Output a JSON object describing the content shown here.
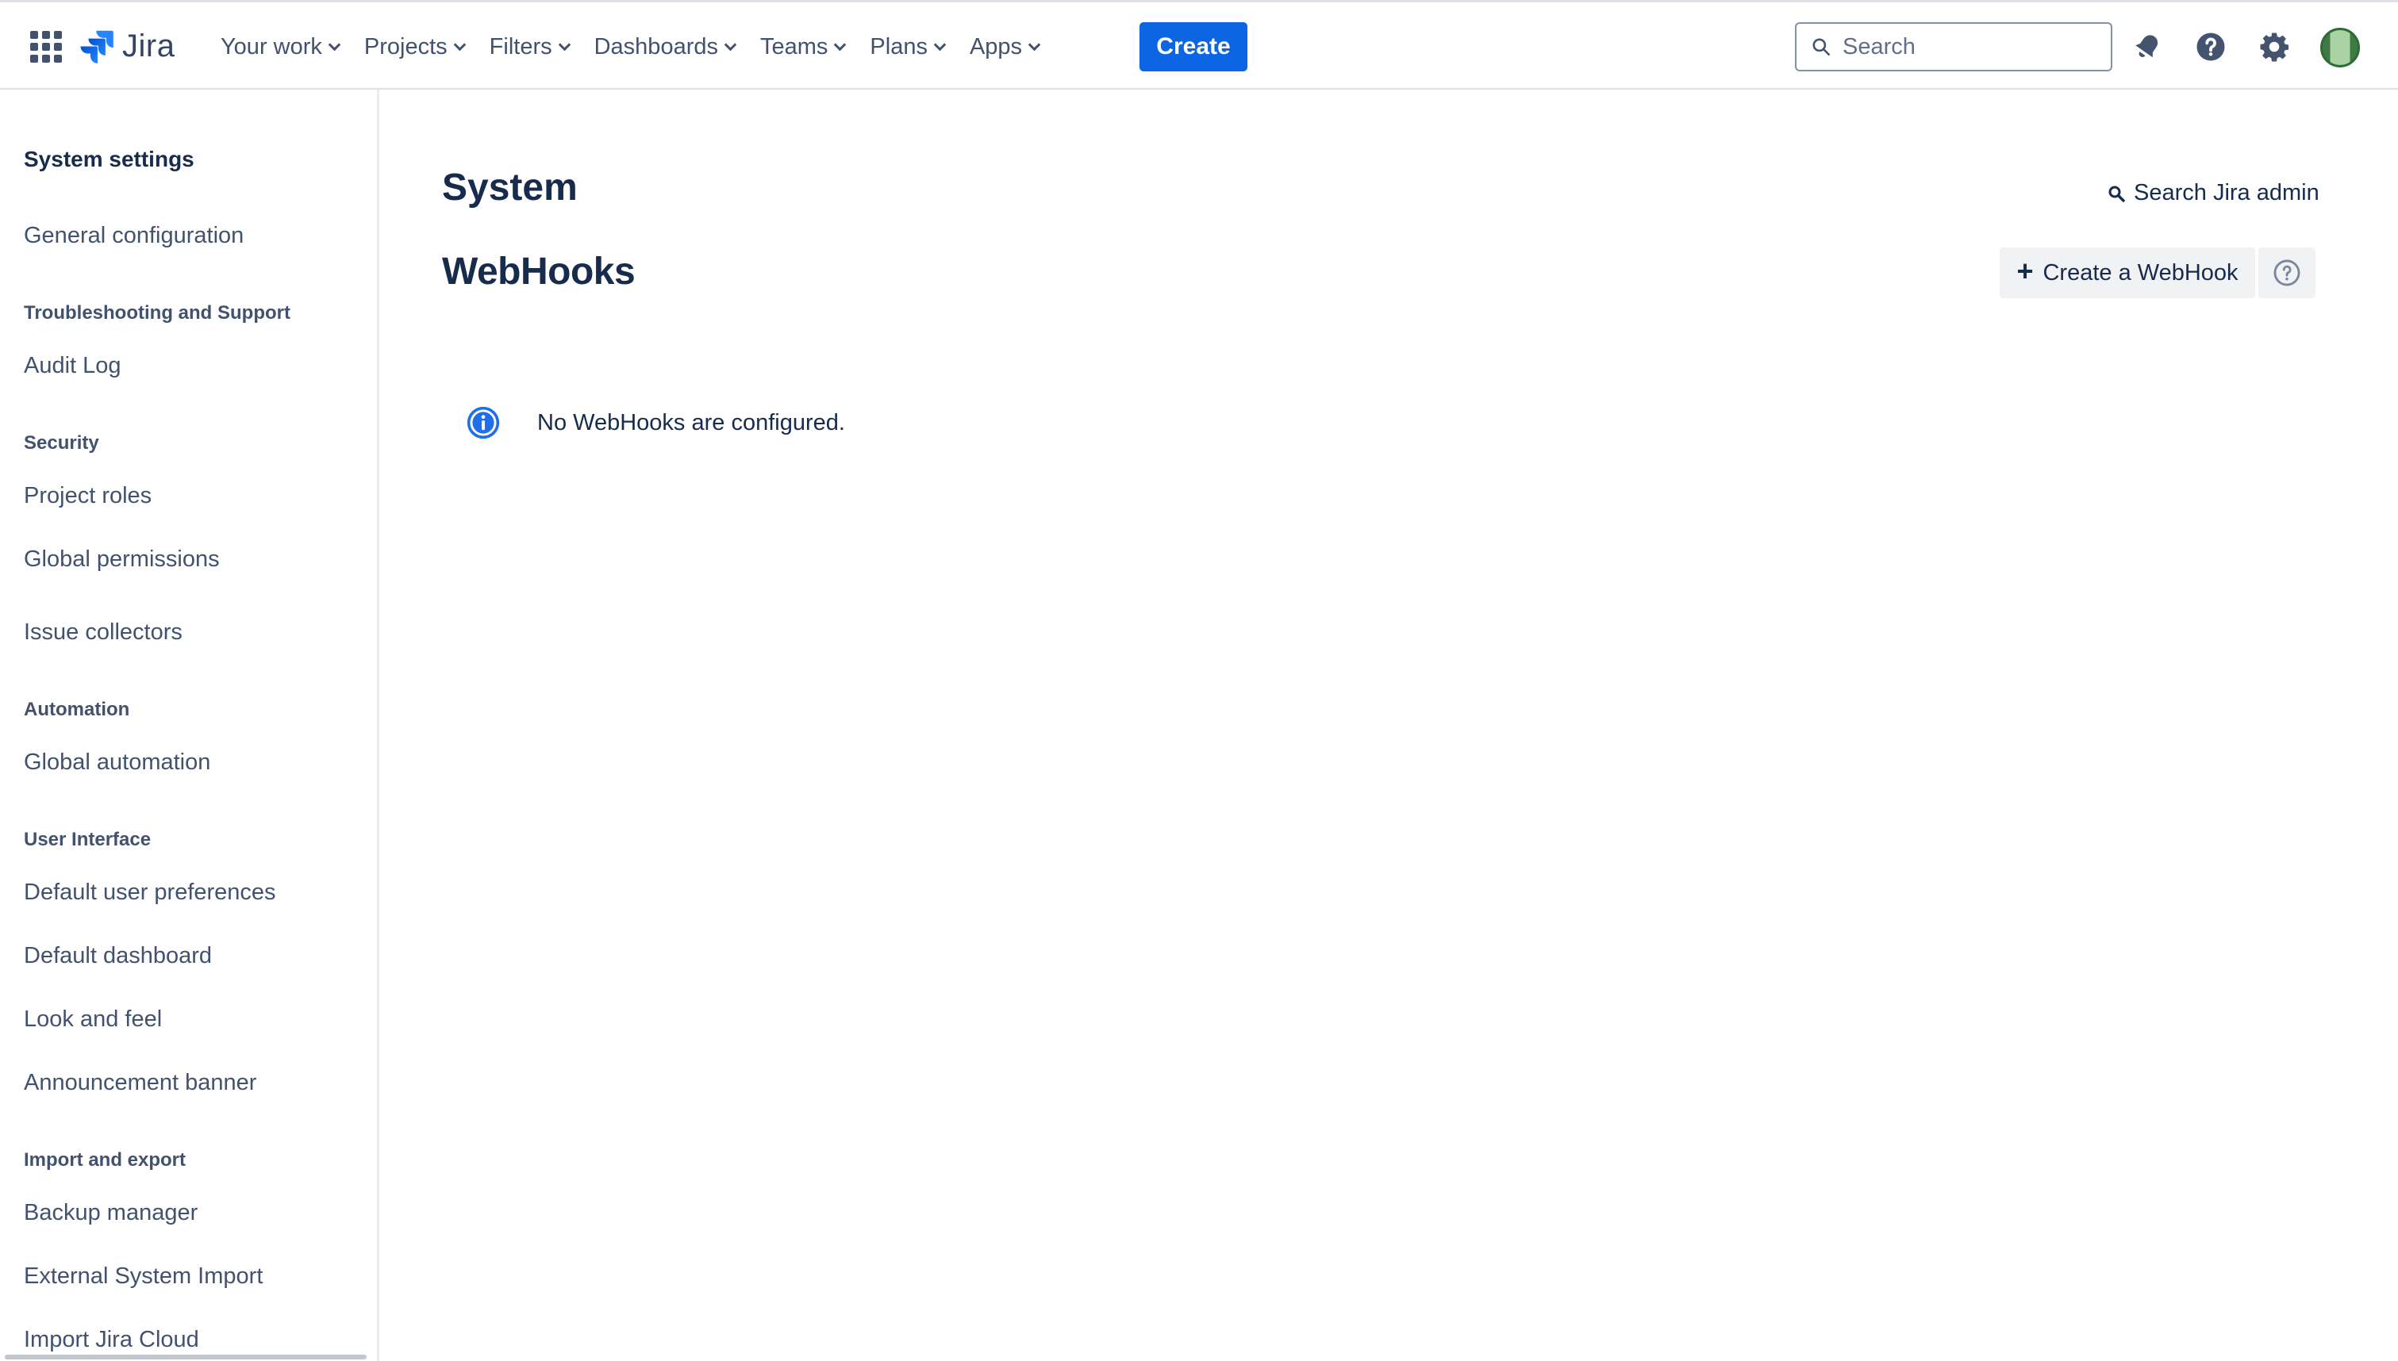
{
  "brand": {
    "logo_text": "Jira",
    "primary_color": "#0c66e4"
  },
  "topnav": {
    "items": [
      {
        "label": "Your work"
      },
      {
        "label": "Projects"
      },
      {
        "label": "Filters"
      },
      {
        "label": "Dashboards"
      },
      {
        "label": "Teams"
      },
      {
        "label": "Plans"
      },
      {
        "label": "Apps"
      }
    ],
    "create_label": "Create",
    "search_placeholder": "Search",
    "icons": [
      "notifications-icon",
      "help-icon",
      "settings-icon",
      "avatar"
    ]
  },
  "sidebar": {
    "title": "System settings",
    "sections": [
      {
        "heading": "",
        "items": [
          "General configuration"
        ]
      },
      {
        "heading": "Troubleshooting and Support",
        "items": [
          "Audit Log"
        ]
      },
      {
        "heading": "Security",
        "items": [
          "Project roles",
          "Global permissions",
          "Issue collectors"
        ]
      },
      {
        "heading": "Automation",
        "items": [
          "Global automation"
        ]
      },
      {
        "heading": "User Interface",
        "items": [
          "Default user preferences",
          "Default dashboard",
          "Look and feel",
          "Announcement banner"
        ]
      },
      {
        "heading": "Import and export",
        "items": [
          "Backup manager",
          "External System Import",
          "Import Jira Cloud"
        ]
      }
    ]
  },
  "main": {
    "page_title": "System",
    "search_admin_label": "Search Jira admin",
    "section_title": "WebHooks",
    "create_webhook_label": "Create a WebHook",
    "empty_message": "No WebHooks are configured."
  }
}
